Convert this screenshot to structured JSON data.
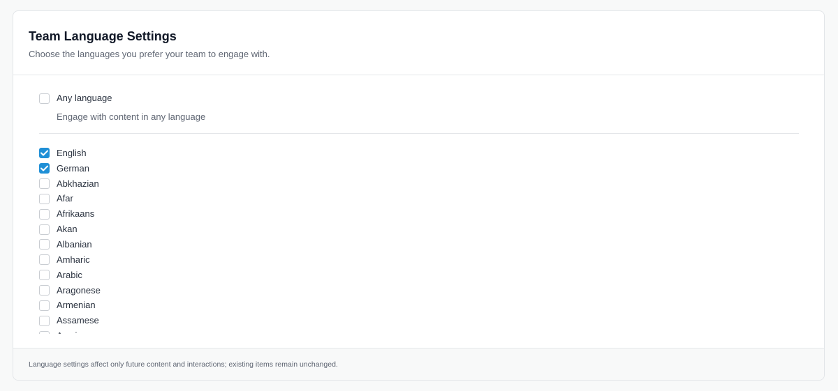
{
  "header": {
    "title": "Team Language Settings",
    "subtitle": "Choose the languages you prefer your team to engage with."
  },
  "any_language": {
    "label": "Any language",
    "description": "Engage with content in any language",
    "checked": false
  },
  "languages": [
    {
      "label": "English",
      "checked": true
    },
    {
      "label": "German",
      "checked": true
    },
    {
      "label": "Abkhazian",
      "checked": false
    },
    {
      "label": "Afar",
      "checked": false
    },
    {
      "label": "Afrikaans",
      "checked": false
    },
    {
      "label": "Akan",
      "checked": false
    },
    {
      "label": "Albanian",
      "checked": false
    },
    {
      "label": "Amharic",
      "checked": false
    },
    {
      "label": "Arabic",
      "checked": false
    },
    {
      "label": "Aragonese",
      "checked": false
    },
    {
      "label": "Armenian",
      "checked": false
    },
    {
      "label": "Assamese",
      "checked": false
    },
    {
      "label": "Avaric",
      "checked": false
    }
  ],
  "footer": {
    "note": "Language settings affect only future content and interactions; existing items remain unchanged."
  },
  "colors": {
    "accent": "#1f8fd6",
    "border": "#e2e5e8",
    "background": "#f8f9f9"
  },
  "icons": {
    "checked": "check-icon"
  }
}
